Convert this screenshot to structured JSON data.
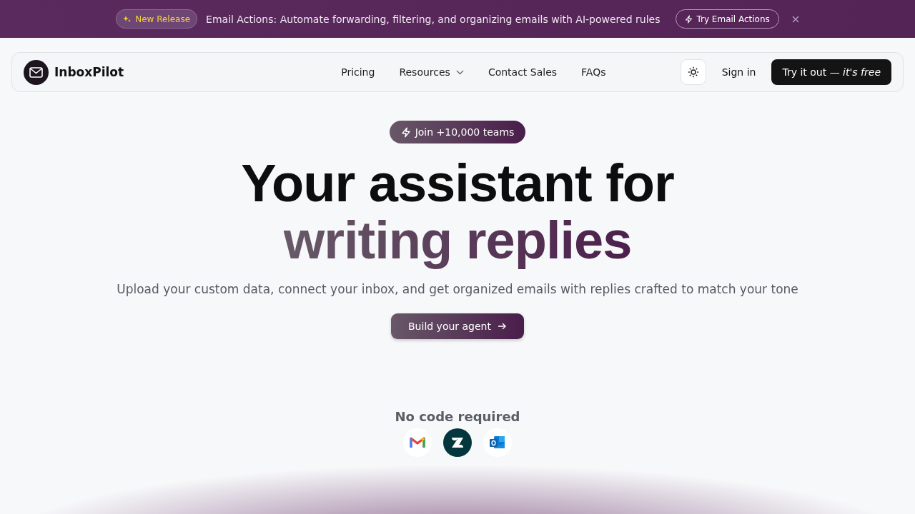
{
  "announcement": {
    "badge": "New Release",
    "message": "Email Actions: Automate forwarding, filtering, and organizing emails with AI-powered rules",
    "action": "Try Email Actions"
  },
  "nav": {
    "brand": "InboxPilot",
    "links": [
      {
        "label": "Pricing",
        "dropdown": false
      },
      {
        "label": "Resources",
        "dropdown": true
      },
      {
        "label": "Contact Sales",
        "dropdown": false
      },
      {
        "label": "FAQs",
        "dropdown": false
      }
    ],
    "sign_in": "Sign in",
    "cta": "Try it out *— it's free*"
  },
  "hero": {
    "badge": "Join +10,000 teams",
    "title_line_1": "Your assistant for",
    "title_line_2": "writing replies",
    "subtitle": "Upload your custom data, connect your inbox, and get organized emails with replies crafted to match your tone",
    "button": "Build your agent"
  },
  "integrations": {
    "heading": "No code required",
    "items": [
      {
        "kind": "gmail"
      },
      {
        "kind": "zendesk"
      },
      {
        "kind": "outlook"
      }
    ]
  }
}
